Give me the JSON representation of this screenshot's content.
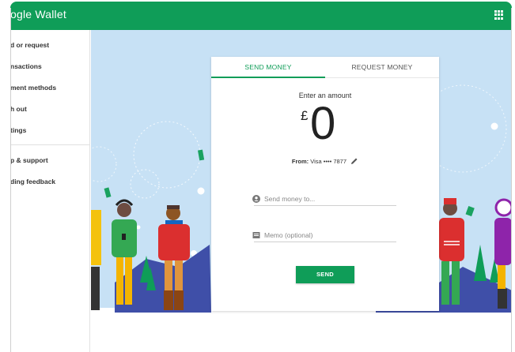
{
  "app": {
    "title": "ogle Wallet"
  },
  "sidebar": {
    "items": [
      {
        "label": "d or request"
      },
      {
        "label": "nsactions"
      },
      {
        "label": "ment methods"
      },
      {
        "label": "h out"
      },
      {
        "label": "tings"
      },
      {
        "label": "p & support"
      },
      {
        "label": "ding feedback"
      }
    ]
  },
  "tabs": [
    {
      "label": "SEND MONEY",
      "active": true
    },
    {
      "label": "REQUEST MONEY",
      "active": false
    }
  ],
  "send_form": {
    "amount_label": "Enter an amount",
    "currency_symbol": "£",
    "amount": "0",
    "from_label": "From:",
    "from_value": "Visa •••• 7877",
    "recipient_placeholder": "Send money to...",
    "memo_placeholder": "Memo (optional)",
    "send_label": "SEND"
  },
  "colors": {
    "brand": "#0f9d58",
    "sky": "#c7e1f5"
  },
  "icons": [
    "apps-grid-icon",
    "pencil-icon",
    "person-icon",
    "memo-icon"
  ]
}
